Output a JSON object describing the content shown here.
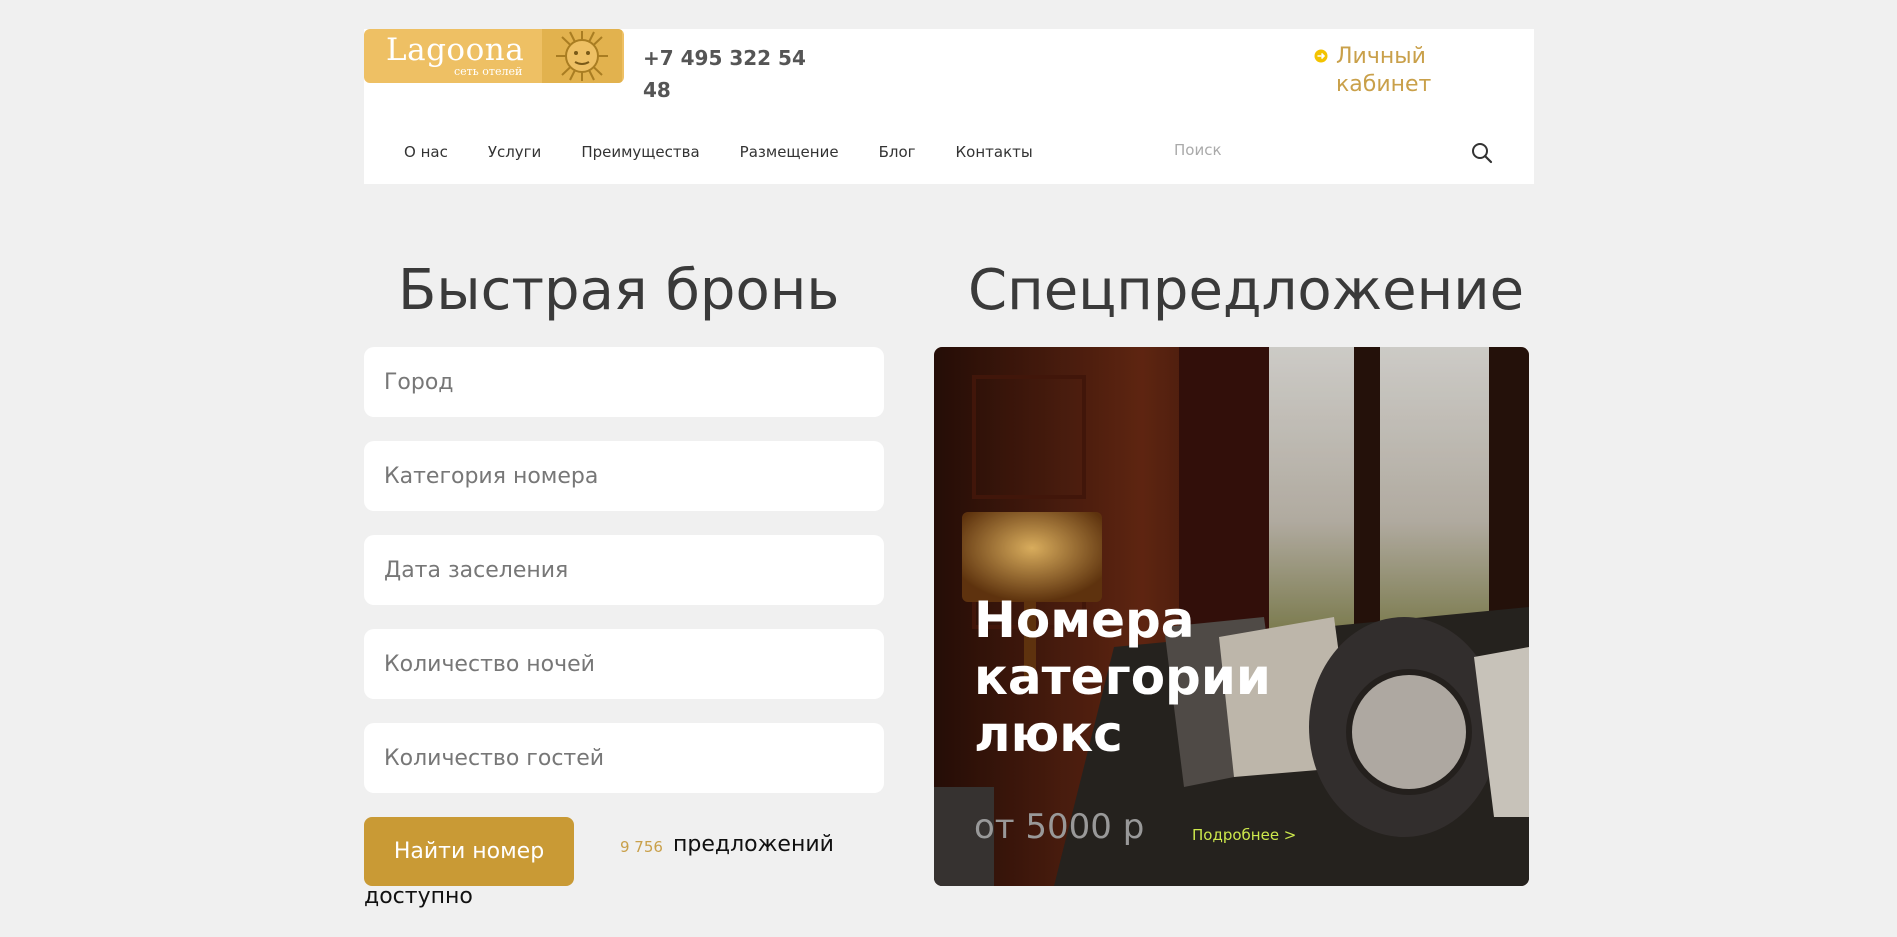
{
  "brand": {
    "name": "Lagoona",
    "subtitle": "сеть отелей",
    "color": "#eec064"
  },
  "header": {
    "phone": "+7 495 322 54 48",
    "cabinet_label": "Личный кабинет",
    "nav": [
      "О нас",
      "Услуги",
      "Преимущества",
      "Размещение",
      "Блог",
      "Контакты"
    ],
    "search_placeholder": "Поиск"
  },
  "booking": {
    "title": "Быстрая бронь",
    "fields": [
      {
        "placeholder": "Город",
        "value": ""
      },
      {
        "placeholder": "Категория номера",
        "value": ""
      },
      {
        "placeholder": "Дата заселения",
        "value": ""
      },
      {
        "placeholder": "Количество ночей",
        "value": ""
      },
      {
        "placeholder": "Количество гостей",
        "value": ""
      }
    ],
    "button_label": "Найти номер",
    "offers_count": "9 756",
    "offers_text": "предложений",
    "offers_text_2": "доступно"
  },
  "special": {
    "title": "Спецпредложение",
    "card_title": "Номера категории люкс",
    "price": "от 5000 р",
    "more_label": "Подробнее >"
  },
  "colors": {
    "accent": "#c99a35",
    "gold_text": "#c9a04a",
    "link_green": "#cde84c",
    "background": "#f0f0f0"
  }
}
